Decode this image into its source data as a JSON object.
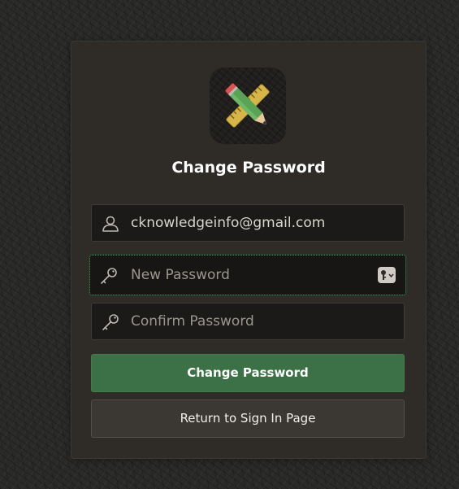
{
  "page": {
    "title": "Change Password"
  },
  "app_icon": {
    "name": "pencil-ruler-icon"
  },
  "fields": {
    "username": {
      "value": "cknowledgeinfo@gmail.com",
      "placeholder": "",
      "icon": "user-icon"
    },
    "new_password": {
      "value": "",
      "placeholder": "New Password",
      "icon": "key-icon",
      "autofill_icon": "keychain-icon"
    },
    "confirm_password": {
      "value": "",
      "placeholder": "Confirm Password",
      "icon": "key-icon"
    }
  },
  "buttons": {
    "change_password": "Change Password",
    "return_sign_in": "Return to Sign In Page"
  },
  "colors": {
    "primary_button": "#3c7047",
    "focus_outline": "#4f9a60",
    "card_bg": "#2f2c28"
  }
}
